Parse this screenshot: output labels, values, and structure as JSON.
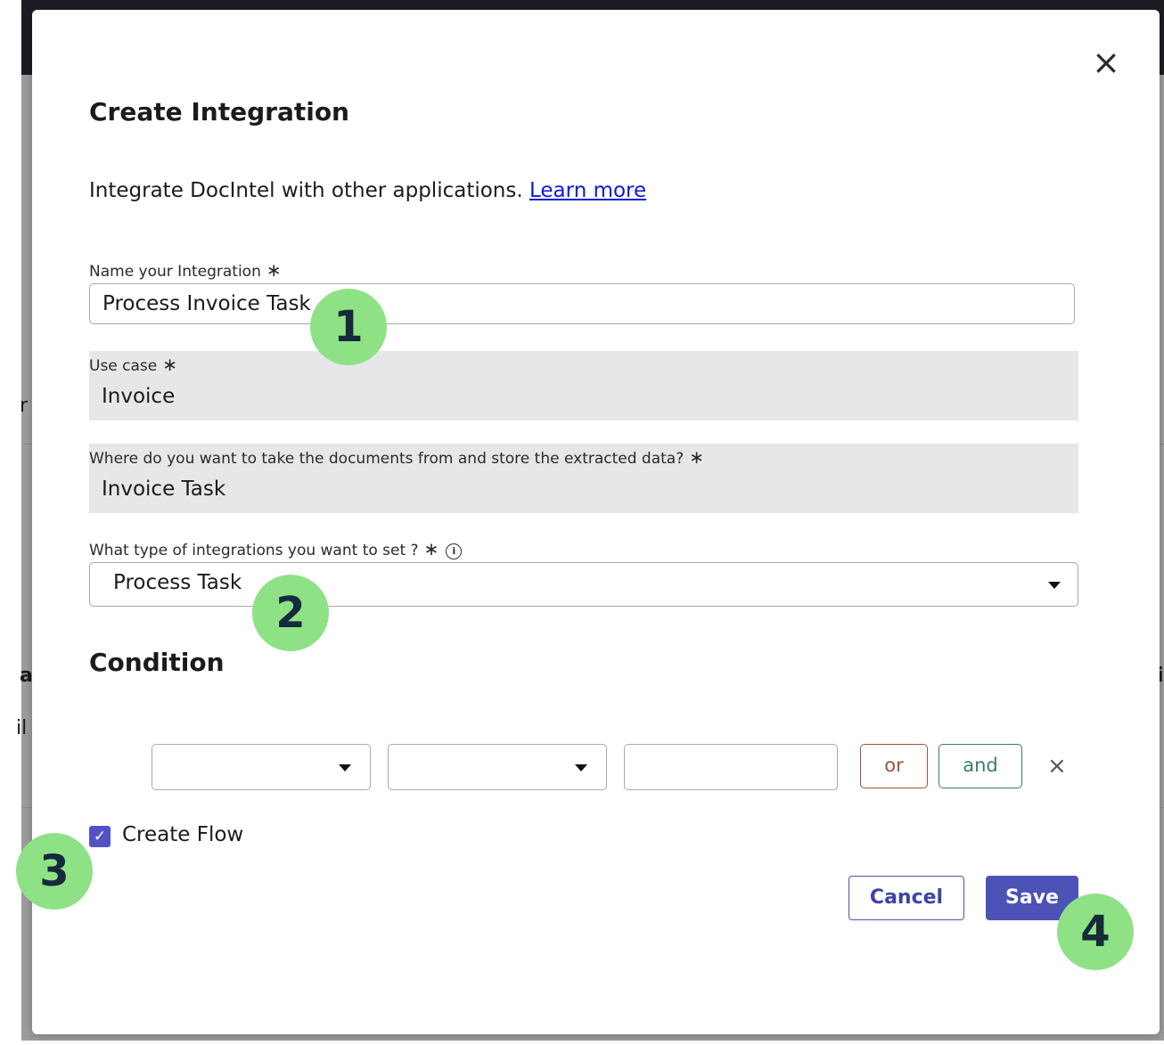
{
  "dialog": {
    "title": "Create Integration",
    "intro_text": "Integrate DocIntel with other applications. ",
    "learn_more_label": "Learn more",
    "close_label": "×"
  },
  "fields": {
    "name": {
      "label": "Name your Integration",
      "required_mark": "∗",
      "value": "Process Invoice Task"
    },
    "use_case": {
      "label": "Use case",
      "required_mark": "∗",
      "value": "Invoice"
    },
    "source": {
      "label": "Where do you want to take the documents from and store the extracted data?",
      "required_mark": "∗",
      "value": "Invoice Task"
    },
    "integration_type": {
      "label": "What type of integrations you want to set ?",
      "required_mark": "∗",
      "info_icon": "i",
      "value": "Process Task"
    }
  },
  "condition": {
    "title": "Condition",
    "field_value": "",
    "operator_value": "",
    "value_input": "",
    "or_label": "or",
    "and_label": "and",
    "remove_label": "×"
  },
  "create_flow": {
    "label": "Create Flow",
    "checked": true,
    "check_glyph": "✓"
  },
  "actions": {
    "cancel_label": "Cancel",
    "save_label": "Save"
  },
  "badges": [
    "1",
    "2",
    "3",
    "4"
  ],
  "colors": {
    "primary": "#4d52b6",
    "checkbox": "#5153c4",
    "badge": "#8ee285",
    "link": "#0a1bd6",
    "or_border": "#a0523a",
    "and_border": "#3e7a78",
    "readonly_bg": "#e7e7ea"
  },
  "background_fragments": [
    "r",
    "a",
    "il",
    "i"
  ]
}
